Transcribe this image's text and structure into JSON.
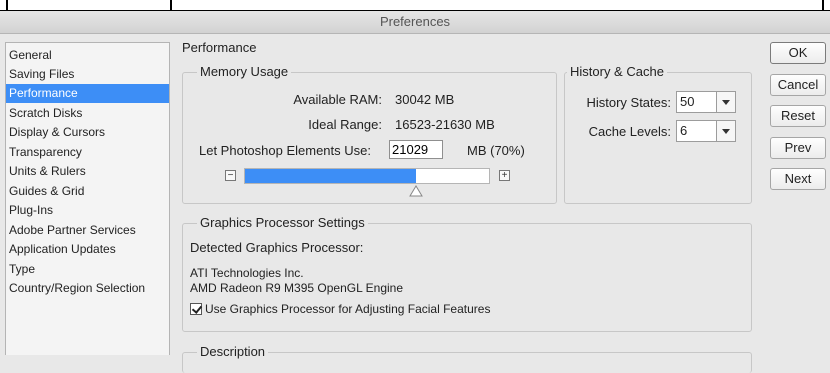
{
  "window": {
    "title": "Preferences"
  },
  "sidebar": {
    "items": [
      {
        "label": "General",
        "selected": false
      },
      {
        "label": "Saving Files",
        "selected": false
      },
      {
        "label": "Performance",
        "selected": true
      },
      {
        "label": "Scratch Disks",
        "selected": false
      },
      {
        "label": "Display & Cursors",
        "selected": false
      },
      {
        "label": "Transparency",
        "selected": false
      },
      {
        "label": "Units & Rulers",
        "selected": false
      },
      {
        "label": "Guides & Grid",
        "selected": false
      },
      {
        "label": "Plug-Ins",
        "selected": false
      },
      {
        "label": "Adobe Partner Services",
        "selected": false
      },
      {
        "label": "Application Updates",
        "selected": false
      },
      {
        "label": "Type",
        "selected": false
      },
      {
        "label": "Country/Region Selection",
        "selected": false
      }
    ]
  },
  "section_title": "Performance",
  "memory": {
    "group_title": "Memory Usage",
    "available_label": "Available RAM:",
    "available_value": "30042 MB",
    "ideal_label": "Ideal Range:",
    "ideal_value": "16523-21630 MB",
    "let_label": "Let Photoshop Elements Use:",
    "let_value": "21029",
    "let_suffix": "MB (70%)",
    "slider_percent": 70,
    "minus": "−",
    "plus": "+"
  },
  "history": {
    "group_title": "History & Cache",
    "states_label": "History States:",
    "states_value": "50",
    "cache_label": "Cache Levels:",
    "cache_value": "6"
  },
  "gpu": {
    "group_title": "Graphics Processor Settings",
    "detected_label": "Detected Graphics Processor:",
    "vendor": "ATI Technologies Inc.",
    "renderer": "AMD Radeon R9 M395 OpenGL Engine",
    "checkbox_label": "Use Graphics Processor for Adjusting Facial Features",
    "checkbox_checked": true
  },
  "description": {
    "group_title": "Description"
  },
  "buttons": {
    "ok": "OK",
    "cancel": "Cancel",
    "reset": "Reset",
    "prev": "Prev",
    "next": "Next"
  },
  "colors": {
    "accent": "#3d8ef6",
    "background": "#e8e8e8"
  }
}
